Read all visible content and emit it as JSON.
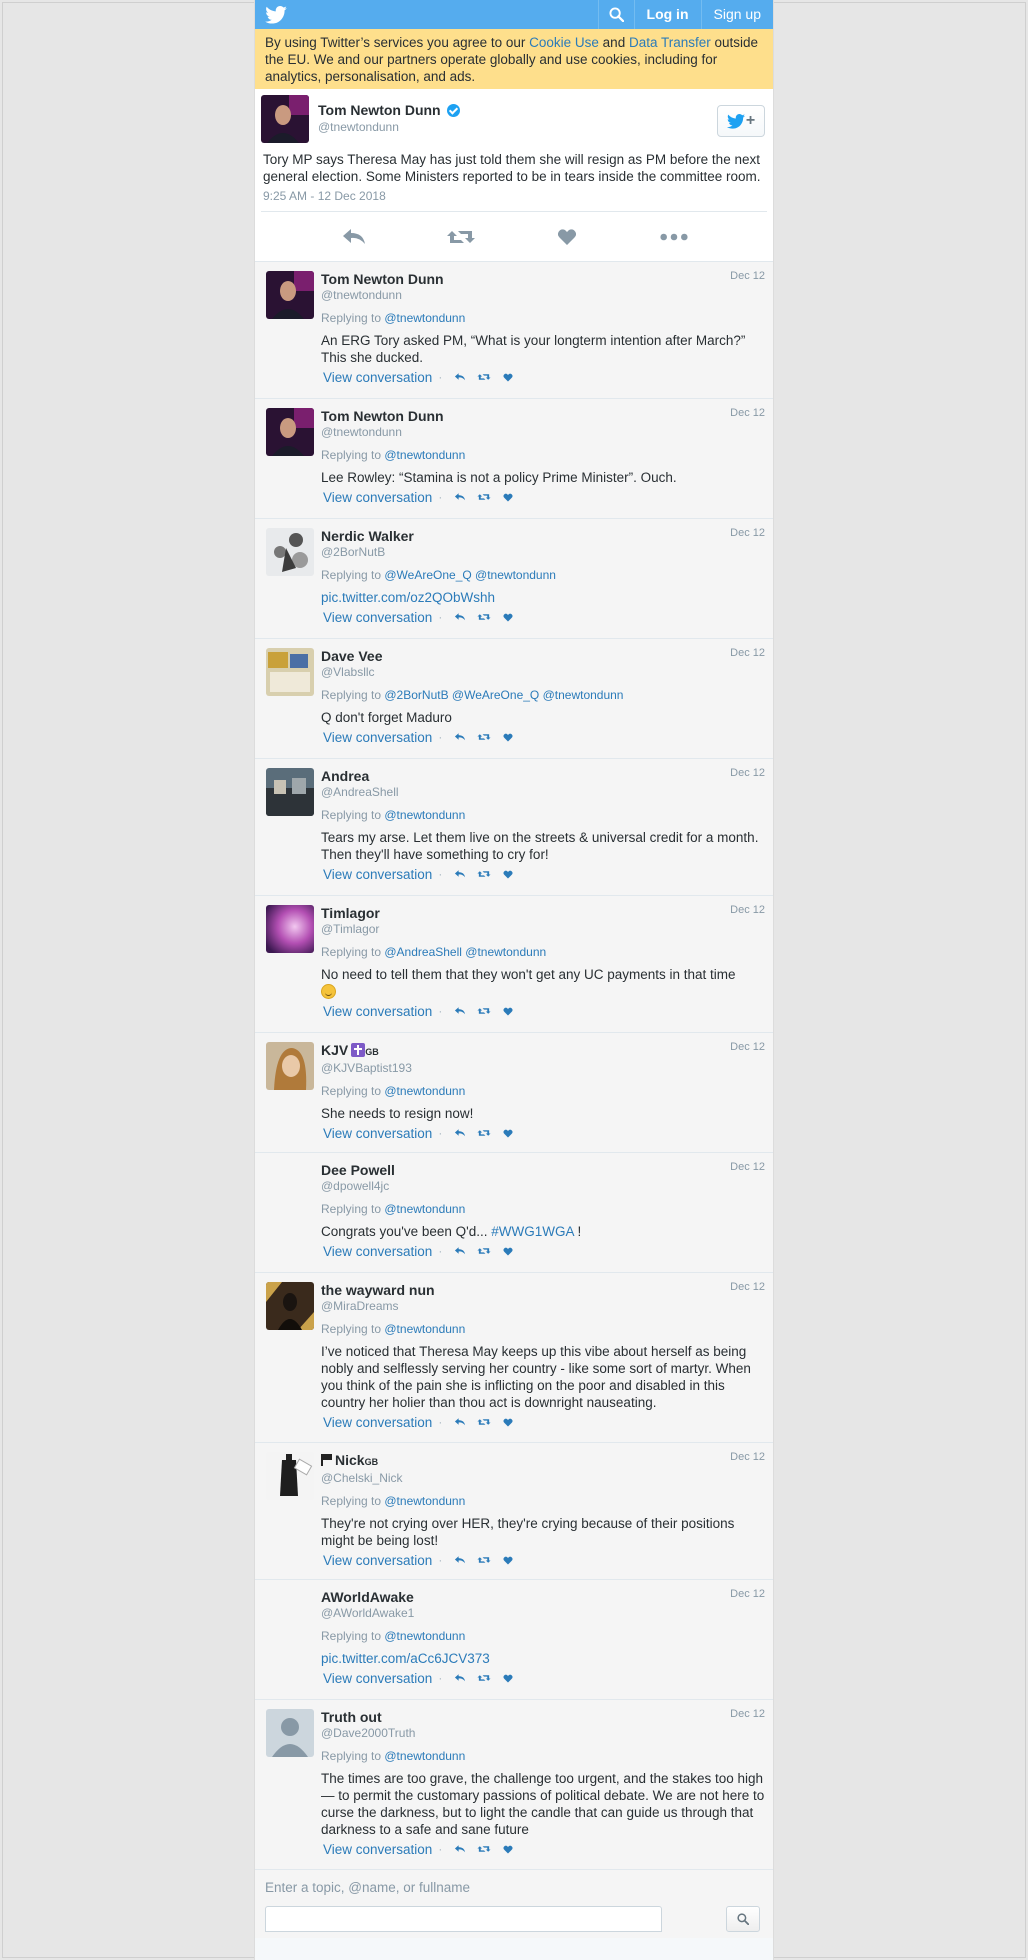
{
  "topbar": {
    "login": "Log in",
    "signup": "Sign up"
  },
  "cookie": {
    "t1": "By using Twitter’s services you agree to our ",
    "link1": "Cookie Use",
    "t2": " and ",
    "link2": "Data Transfer",
    "t3": " outside the EU. We and our partners operate globally and use cookies, including for analytics, personalisation, and ads."
  },
  "main_tweet": {
    "name": "Tom Newton Dunn",
    "handle": "@tnewtondunn",
    "text": "Tory MP says Theresa May has just told them she will resign as PM before the next general election. Some Ministers reported to be in tears inside the committee room.",
    "time": "9:25 AM - 12 Dec 2018"
  },
  "colors": {
    "brand": "#55acee",
    "link": "#2b7bb9",
    "cookie_bg": "#fedf8c"
  },
  "replies": [
    {
      "name": "Tom Newton Dunn",
      "handle": "@tnewtondunn",
      "date": "Dec 12",
      "replying": "@tnewtondunn",
      "text": "An ERG Tory asked PM, “What is your longterm intention after March?” This she ducked.",
      "view": "View conversation"
    },
    {
      "name": "Tom Newton Dunn",
      "handle": "@tnewtondunn",
      "date": "Dec 12",
      "replying": "@tnewtondunn",
      "text": "Lee Rowley: “Stamina is not a policy Prime Minister”. Ouch.",
      "view": "View conversation"
    },
    {
      "name": "Nerdic Walker",
      "handle": "@2BorNutB",
      "date": "Dec 12",
      "replying": "@WeAreOne_Q @tnewtondunn",
      "link": "pic.twitter.com/oz2QObWshh",
      "view": "View conversation"
    },
    {
      "name": "Dave Vee",
      "handle": "@Vlabsllc",
      "date": "Dec 12",
      "replying": "@2BorNutB @WeAreOne_Q @tnewtondunn",
      "text": "Q don't forget Maduro",
      "view": "View conversation"
    },
    {
      "name": "Andrea",
      "handle": "@AndreaShell",
      "date": "Dec 12",
      "replying": "@tnewtondunn",
      "text": "Tears my arse. Let them live on the streets & universal credit for a month. Then they'll have something to cry for!",
      "view": "View conversation"
    },
    {
      "name": "Timlagor",
      "handle": "@Timlagor",
      "date": "Dec 12",
      "replying": "@AndreaShell @tnewtondunn",
      "text": "No need to tell them that they won't get any UC payments in that time",
      "view": "View conversation"
    },
    {
      "name": "KJV",
      "name_suffix": "GB",
      "handle": "@KJVBaptist193",
      "date": "Dec 12",
      "replying": "@tnewtondunn",
      "text": "She needs to resign now!",
      "view": "View conversation"
    },
    {
      "name": "Dee Powell",
      "handle": "@dpowell4jc",
      "date": "Dec 12",
      "replying": "@tnewtondunn",
      "text": "Congrats you've been Q'd... ",
      "hashtag": "#WWG1WGA",
      "text_end": " !",
      "view": "View conversation"
    },
    {
      "name": "the wayward nun",
      "handle": "@MiraDreams",
      "date": "Dec 12",
      "replying": "@tnewtondunn",
      "text": "I’ve noticed that Theresa May keeps up this vibe about herself as being nobly and selflessly serving her country - like some sort of martyr. When you think of the pain she is inflicting on the poor and disabled in this country her holier than thou act is downright nauseating.",
      "view": "View conversation"
    },
    {
      "name": "Nick",
      "name_suffix": "GB",
      "handle": "@Chelski_Nick",
      "date": "Dec 12",
      "replying": "@tnewtondunn",
      "text": "They're not crying over HER, they're crying because of their positions might be being lost!",
      "view": "View conversation"
    },
    {
      "name": "AWorldAwake",
      "handle": "@AWorldAwake1",
      "date": "Dec 12",
      "replying": "@tnewtondunn",
      "link": "pic.twitter.com/aCc6JCV373",
      "view": "View conversation"
    },
    {
      "name": "Truth out",
      "handle": "@Dave2000Truth",
      "date": "Dec 12",
      "replying": "@tnewtondunn",
      "text": "The times are too grave, the challenge too urgent, and the stakes too high — to permit the customary passions of political debate. We are not here to curse the darkness, but to light the candle that can guide us through that darkness to a safe and sane future",
      "view": "View conversation"
    }
  ],
  "common": {
    "replying_to": "Replying to "
  },
  "footer": {
    "hint": "Enter a topic, @name, or fullname"
  }
}
